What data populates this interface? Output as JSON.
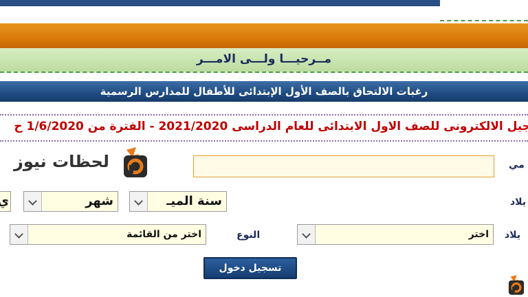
{
  "header": {
    "welcome": "مــرحيـــا ولـــى الامـــر",
    "title": "رغبات الالتحاق بالصف الأول الإبتدائى للأطفال للمدارس الرسمية",
    "notice": "جيل الالكترونى للصف الاول الابتدائى للعام الدراسى 2021/2020 - الفترة من 1/6/2020 ح"
  },
  "form": {
    "name_label": "مي",
    "name_value": "",
    "birth_label": "يلاد",
    "birth_year": "سنة الميـ",
    "birth_month": "شهر",
    "birth_day": "ي",
    "place_label": "يلاد",
    "place_value": "اختر",
    "gender_label": "النوع",
    "gender_value": "اختر من القائمة",
    "submit_label": "تسجيل دخول"
  },
  "watermark": {
    "text": "لحظات نيوز"
  },
  "colors": {
    "orange": "#d97a0a",
    "navy": "#1f4b82",
    "notice_red": "#c00000",
    "logo_orange": "#e87a1a"
  }
}
